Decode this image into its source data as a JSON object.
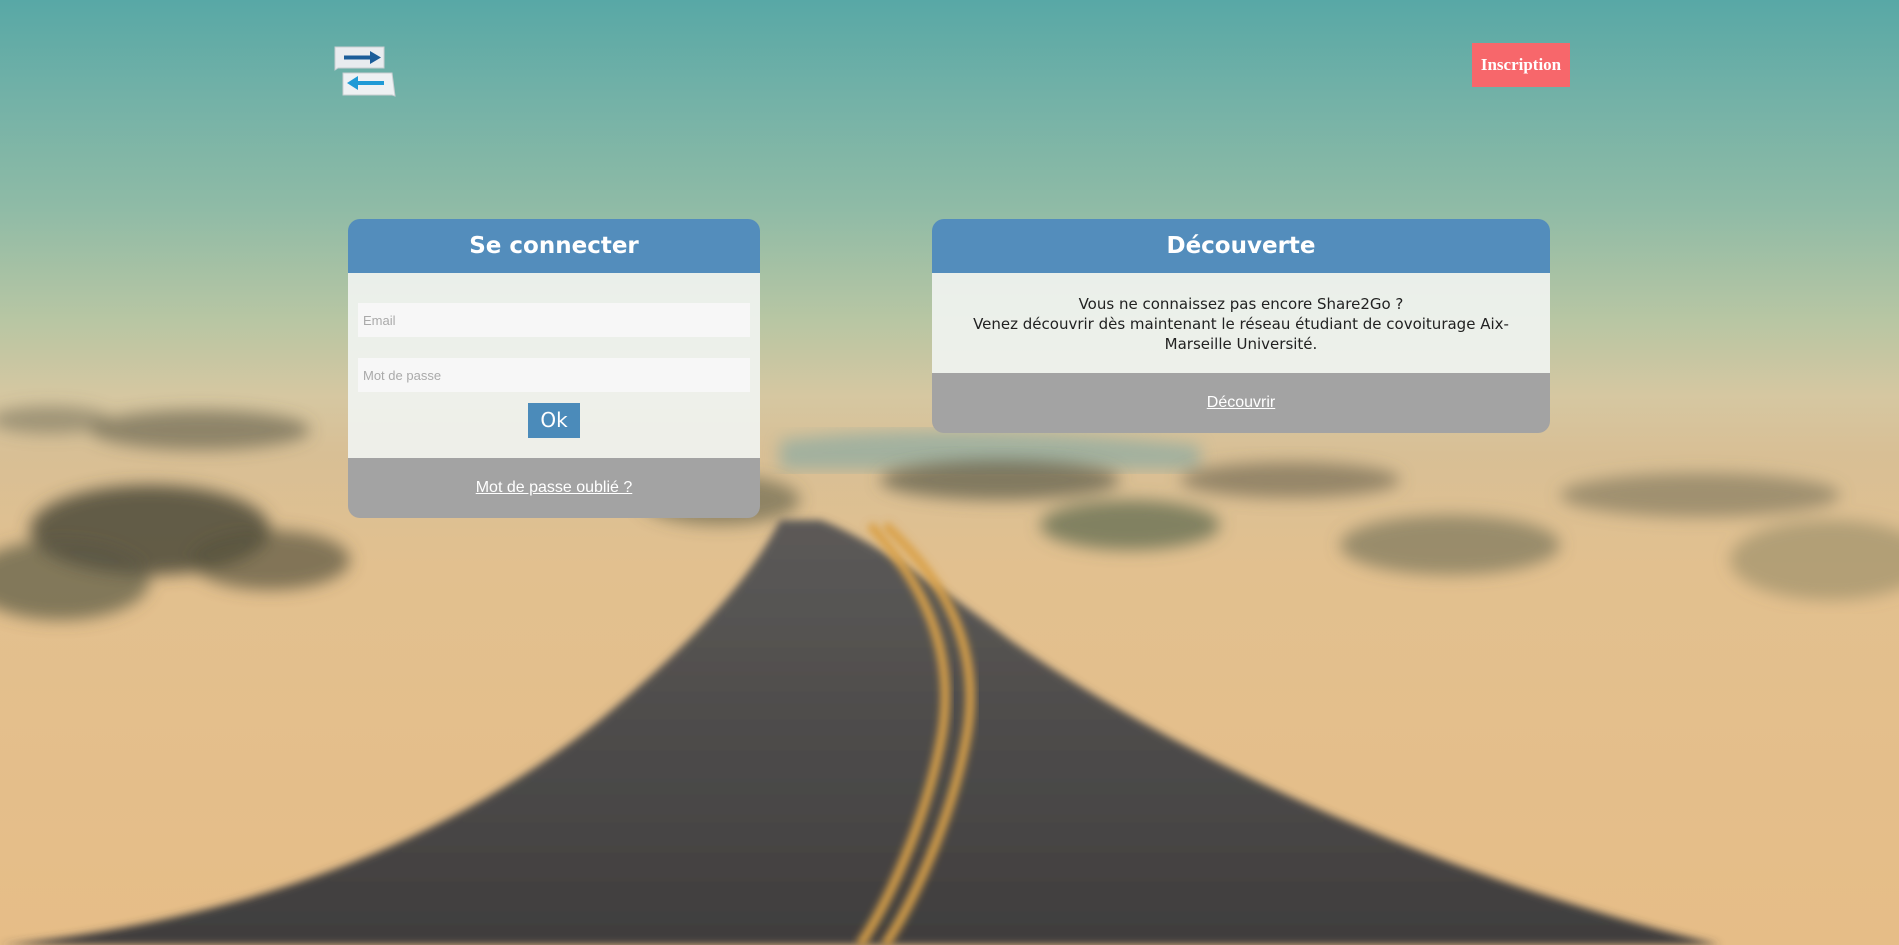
{
  "header": {
    "logo_icon": "share2go-arrows-logo",
    "signup_label": "Inscription",
    "signup_color": "#f7676b"
  },
  "login": {
    "title": "Se connecter",
    "email_placeholder": "Email",
    "password_placeholder": "Mot de passe",
    "submit_label": "Ok",
    "forgot_password_label": "Mot de passe oublié ?"
  },
  "discover": {
    "title": "Découverte",
    "line1": "Vous ne connaissez pas encore Share2Go ?",
    "line2": "Venez découvrir dès maintenant le réseau étudiant de covoiturage Aix-Marseille Université.",
    "link_label": "Découvrir"
  },
  "colors": {
    "card_header": "#538dbc",
    "card_footer": "#a3a3a3",
    "ok_button": "#4b8bba"
  }
}
